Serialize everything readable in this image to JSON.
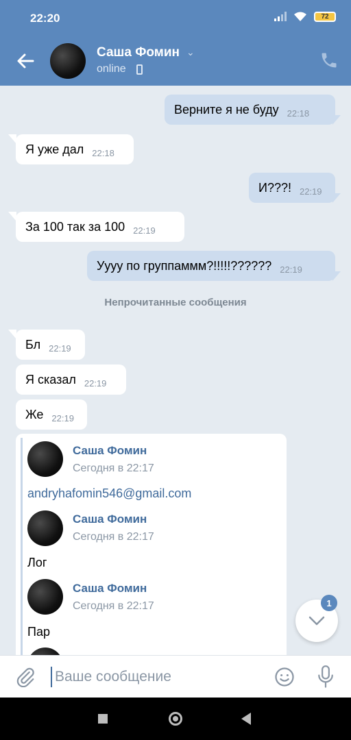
{
  "status_bar": {
    "time": "22:20",
    "battery": "72"
  },
  "header": {
    "name": "Саша Фомин",
    "status": "online"
  },
  "messages": [
    {
      "dir": "out",
      "text": "Верните я не буду",
      "time": "22:18"
    },
    {
      "dir": "in",
      "text": "Я уже дал",
      "time": "22:18"
    },
    {
      "dir": "out",
      "text": "И???!",
      "time": "22:19"
    },
    {
      "dir": "in",
      "text": "За 100 так за 100",
      "time": "22:19"
    },
    {
      "dir": "out",
      "text": "Уууу по группаммм?!!!!!??????",
      "time": "22:19"
    },
    {
      "dir": "in",
      "text": "Бл",
      "time": "22:19"
    },
    {
      "dir": "in",
      "text": "Я сказал",
      "time": "22:19"
    },
    {
      "dir": "in",
      "text": "Же",
      "time": "22:19"
    }
  ],
  "unread_divider": "Непрочитанные сообщения",
  "forwarded": [
    {
      "author": "Саша Фомин",
      "date": "Сегодня в 22:17",
      "text": "andryhafomin546@gmail.com",
      "is_link": true
    },
    {
      "author": "Саша Фомин",
      "date": "Сегодня в 22:17",
      "text": "Лог",
      "is_link": false
    },
    {
      "author": "Саша Фомин",
      "date": "Сегодня в 22:17",
      "text": "Пар",
      "is_link": false
    }
  ],
  "scroll_down": {
    "badge": "1"
  },
  "composer": {
    "placeholder": "Ваше сообщение"
  },
  "colors": {
    "header_bg": "#5b88bd",
    "chat_bg": "#e5ebf1",
    "outgoing_bubble": "#cddcee",
    "incoming_bubble": "#ffffff",
    "link": "#3f6a9b"
  },
  "icons": {
    "back": "arrow-left-icon",
    "call": "phone-icon",
    "attach": "paperclip-icon",
    "emoji": "smile-icon",
    "mic": "microphone-icon",
    "scroll": "chevron-down-icon"
  }
}
